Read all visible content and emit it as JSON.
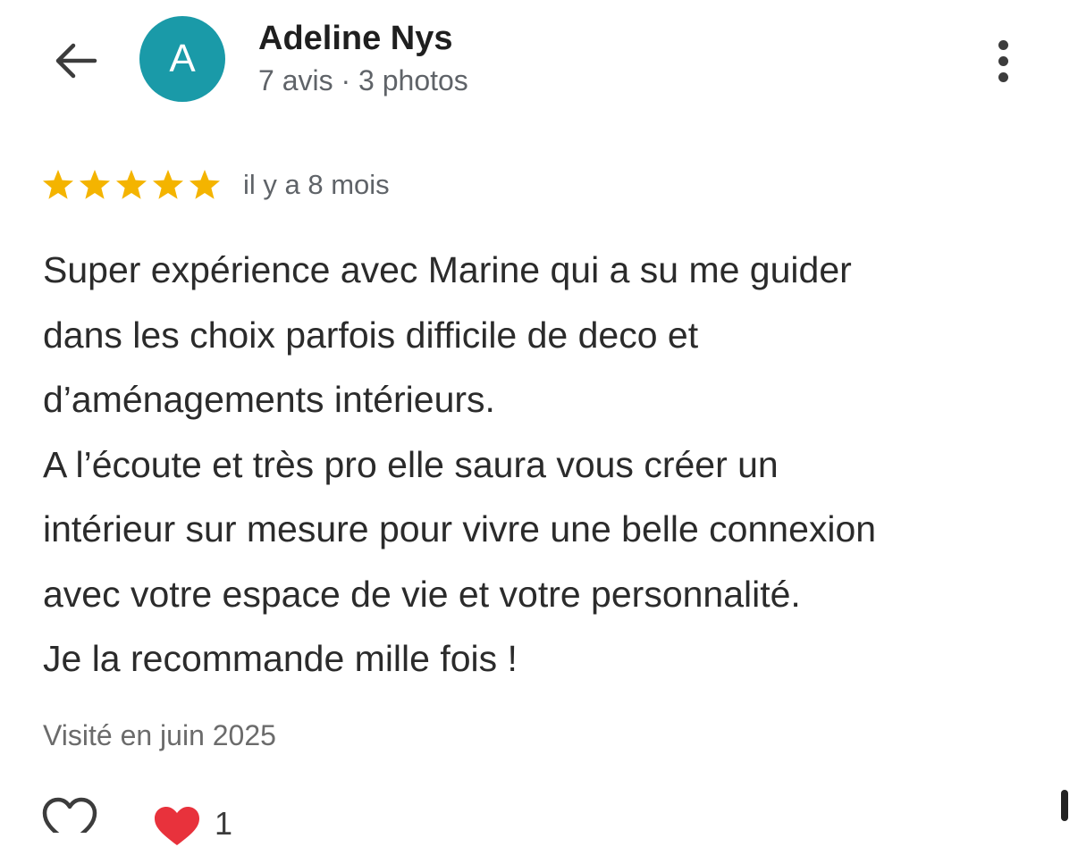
{
  "header": {
    "back_icon": "arrow-left-icon",
    "avatar_letter": "A",
    "avatar_color": "#1a9aa8",
    "reviewer_name": "Adeline Nys",
    "reviewer_stats": "7 avis · 3 photos",
    "more_icon": "more-vertical-icon"
  },
  "review": {
    "rating": 5,
    "rating_max": 5,
    "star_color": "#f4b400",
    "time_ago": "il y a 8 mois",
    "text_lines": [
      "Super expérience avec Marine qui a su me guider",
      "dans les choix parfois difficile de deco et",
      "d’aménagements intérieurs.",
      "A l’écoute et très pro elle saura vous créer un",
      "intérieur sur mesure pour vivre une belle connexion",
      "avec votre espace de vie et votre personnalité.",
      "Je la recommande mille fois !"
    ],
    "visited": "Visité en juin 2025"
  },
  "actions": {
    "like_icon": "heart-outline-icon",
    "reaction_icon": "red-heart-icon",
    "reaction_count": "1"
  }
}
